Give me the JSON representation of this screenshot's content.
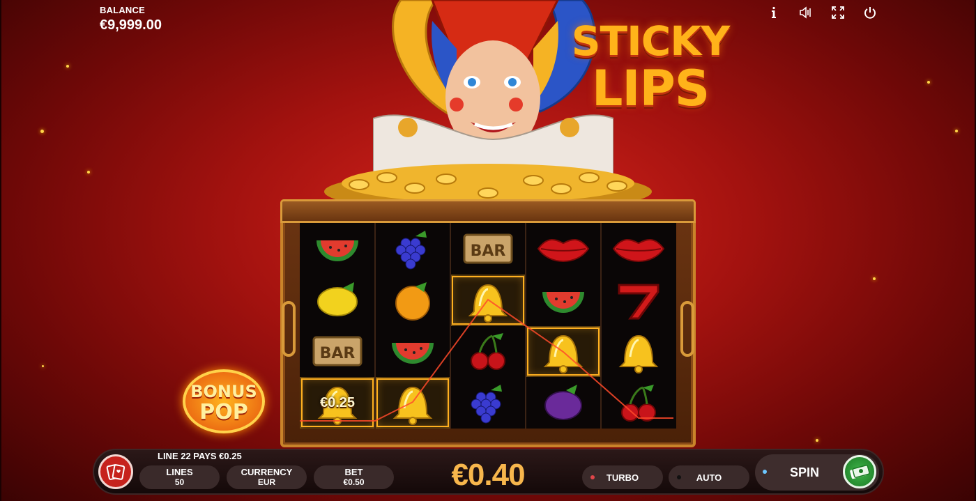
{
  "balance": {
    "label": "BALANCE",
    "value": "€9,999.00"
  },
  "title": {
    "line1": "STICKY",
    "line2": "LIPS"
  },
  "top_icons": [
    "info-icon",
    "sound-icon",
    "fullscreen-icon",
    "power-icon"
  ],
  "reels": [
    [
      "watermelon",
      "grapes",
      "bar",
      "lips",
      "lips"
    ],
    [
      "lemon",
      "orange",
      "bell",
      "watermelon",
      "seven"
    ],
    [
      "bar",
      "watermelon",
      "cherries",
      "bell",
      "bell"
    ],
    [
      "bell",
      "bell",
      "grapes",
      "plum",
      "cherries"
    ]
  ],
  "win": {
    "value": "€0.25"
  },
  "bonus": {
    "line1": "BONUS",
    "line2": "POP"
  },
  "console": {
    "message": "LINE 22 PAYS €0.25",
    "lines": {
      "label": "LINES",
      "value": "50"
    },
    "currency": {
      "label": "CURRENCY",
      "value": "EUR"
    },
    "bet": {
      "label": "BET",
      "value": "€0.50"
    },
    "stake": "€0.40",
    "turbo": "TURBO",
    "auto": "AUTO",
    "spin": "SPIN"
  },
  "colors": {
    "accent": "#f7b64c",
    "win_outline": "#ffb020",
    "background": "#a3120f",
    "spin_button": "#3fb54a"
  }
}
